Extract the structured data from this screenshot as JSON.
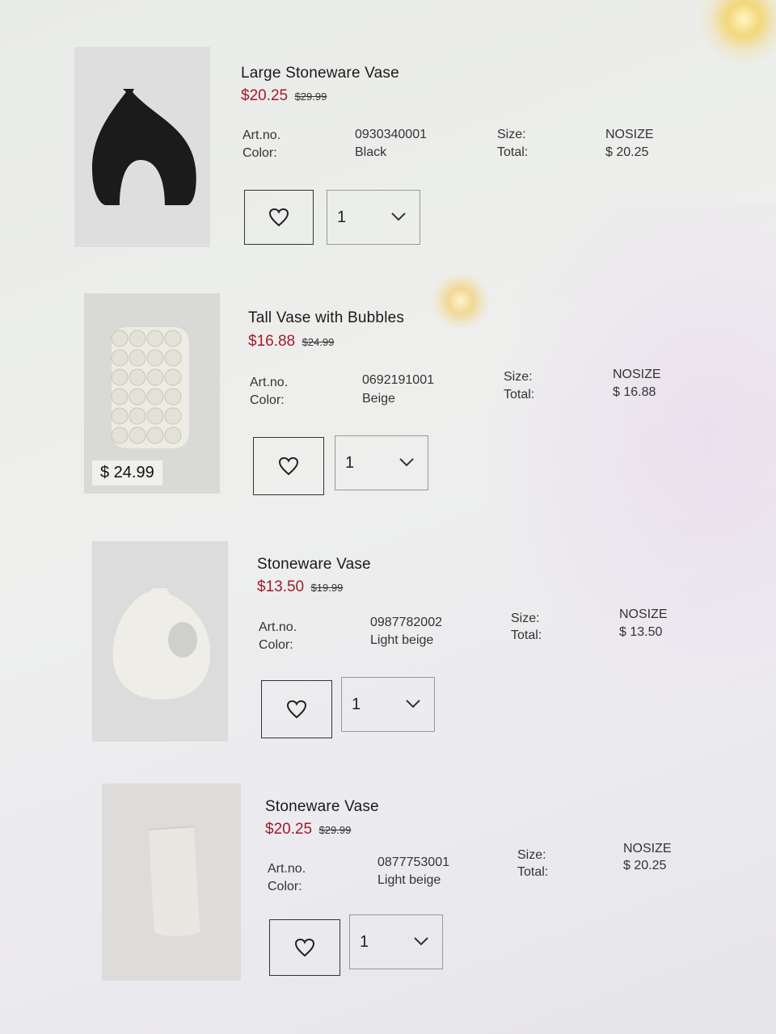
{
  "items": [
    {
      "title": "Large Stoneware Vase",
      "sale_price": "$20.25",
      "old_price": "$29.99",
      "artno_label": "Art.no.",
      "artno": "0930340001",
      "color_label": "Color:",
      "color": "Black",
      "size_label": "Size:",
      "size": "NOSIZE",
      "total_label": "Total:",
      "total": "$ 20.25",
      "quantity": "1",
      "image_badge": ""
    },
    {
      "title": "Tall Vase with Bubbles",
      "sale_price": "$16.88",
      "old_price": "$24.99",
      "artno_label": "Art.no.",
      "artno": "0692191001",
      "color_label": "Color:",
      "color": "Beige",
      "size_label": "Size:",
      "size": "NOSIZE",
      "total_label": "Total:",
      "total": "$ 16.88",
      "quantity": "1",
      "image_badge": "$ 24.99"
    },
    {
      "title": "Stoneware Vase",
      "sale_price": "$13.50",
      "old_price": "$19.99",
      "artno_label": "Art.no.",
      "artno": "0987782002",
      "color_label": "Color:",
      "color": "Light beige",
      "size_label": "Size:",
      "size": "NOSIZE",
      "total_label": "Total:",
      "total": "$ 13.50",
      "quantity": "1",
      "image_badge": ""
    },
    {
      "title": "Stoneware Vase",
      "sale_price": "$20.25",
      "old_price": "$29.99",
      "artno_label": "Art.no.",
      "artno": "0877753001",
      "color_label": "Color:",
      "color": "Light beige",
      "size_label": "Size:",
      "size": "NOSIZE",
      "total_label": "Total:",
      "total": "$ 20.25",
      "quantity": "1",
      "image_badge": ""
    }
  ],
  "icons": {
    "favorite": "heart-icon",
    "dropdown": "chevron-down-icon"
  },
  "colors": {
    "sale": "#a11b2e",
    "text": "#222222"
  }
}
